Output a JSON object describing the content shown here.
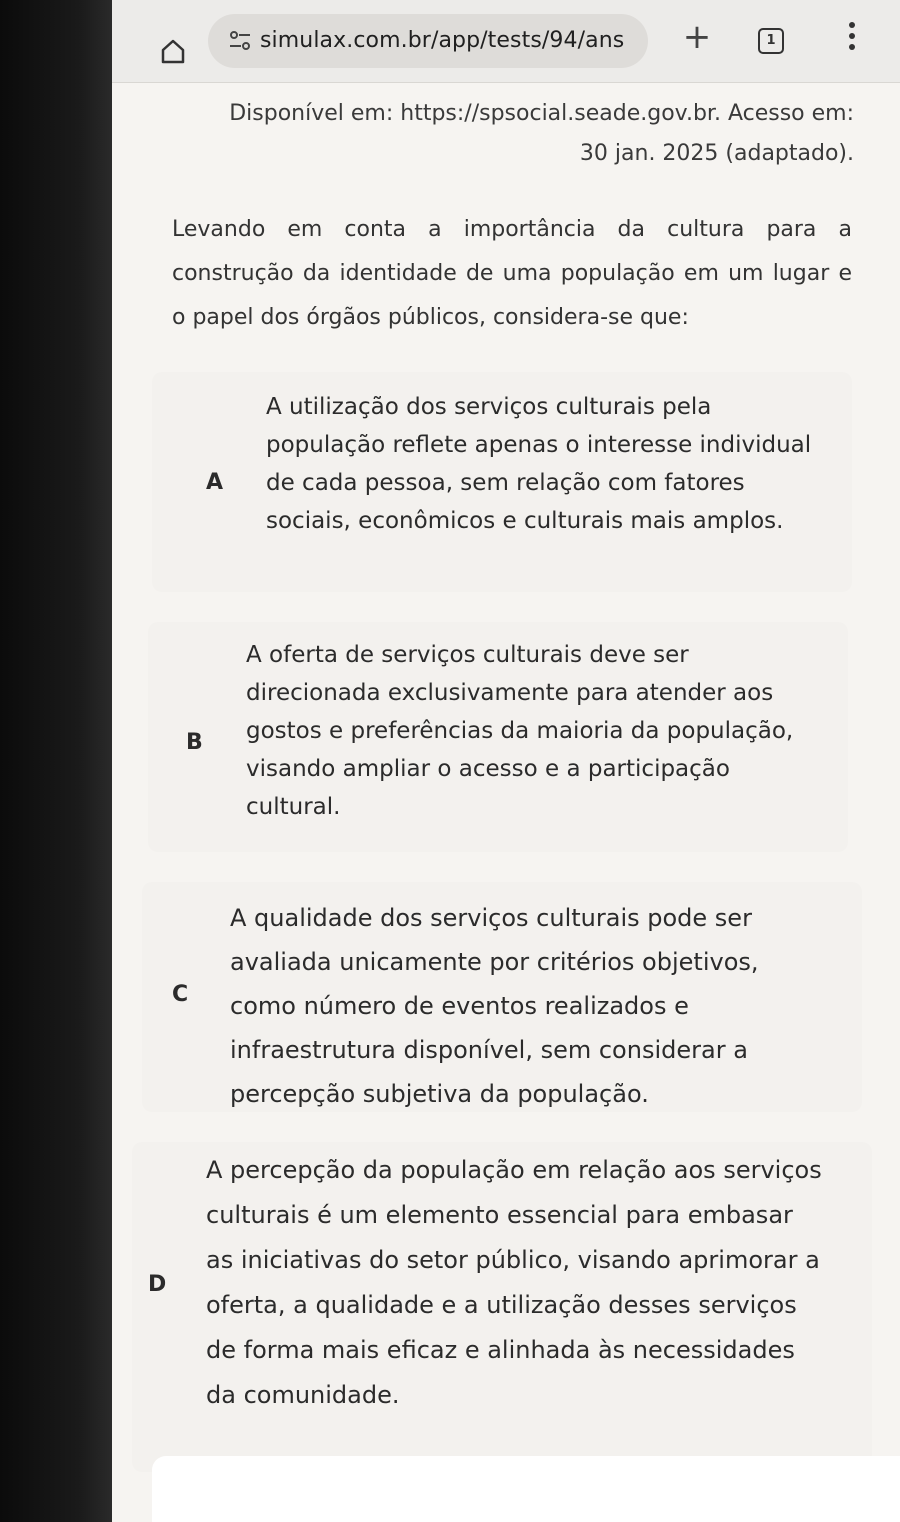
{
  "browser": {
    "url": "simulax.com.br/app/tests/94/ans",
    "new_tab_label": "+",
    "tab_count": "1"
  },
  "question": {
    "source_lines": [
      "Disponível em: https://spsocial.seade.gov.br. Acesso em:",
      "30 jan. 2025 (adaptado)."
    ],
    "stem": "Levando em conta a importância da cultura para a construção da identidade de uma população em um lugar e o papel dos órgãos públicos, considera-se que:"
  },
  "options": [
    {
      "letter": "A",
      "text": "A utilização dos serviços culturais pela população reflete apenas o interesse individual de cada pessoa, sem relação com fatores sociais, econômicos e culturais mais amplos."
    },
    {
      "letter": "B",
      "text": "A oferta de serviços culturais deve ser direcionada exclusivamente para atender aos gostos e preferências da maioria da população, visando ampliar o acesso e a participação cultural."
    },
    {
      "letter": "C",
      "text": "A qualidade dos serviços culturais pode ser avaliada unicamente por critérios objetivos, como número de eventos realizados e infraestrutura disponível, sem considerar a percepção subjetiva da população."
    },
    {
      "letter": "D",
      "text": "A percepção da população em relação aos serviços culturais é um elemento essencial para embasar as iniciativas do setor público, visando aprimorar a oferta, a qualidade e a utilização desses serviços de forma mais eficaz e alinhada às necessidades da comunidade."
    }
  ]
}
